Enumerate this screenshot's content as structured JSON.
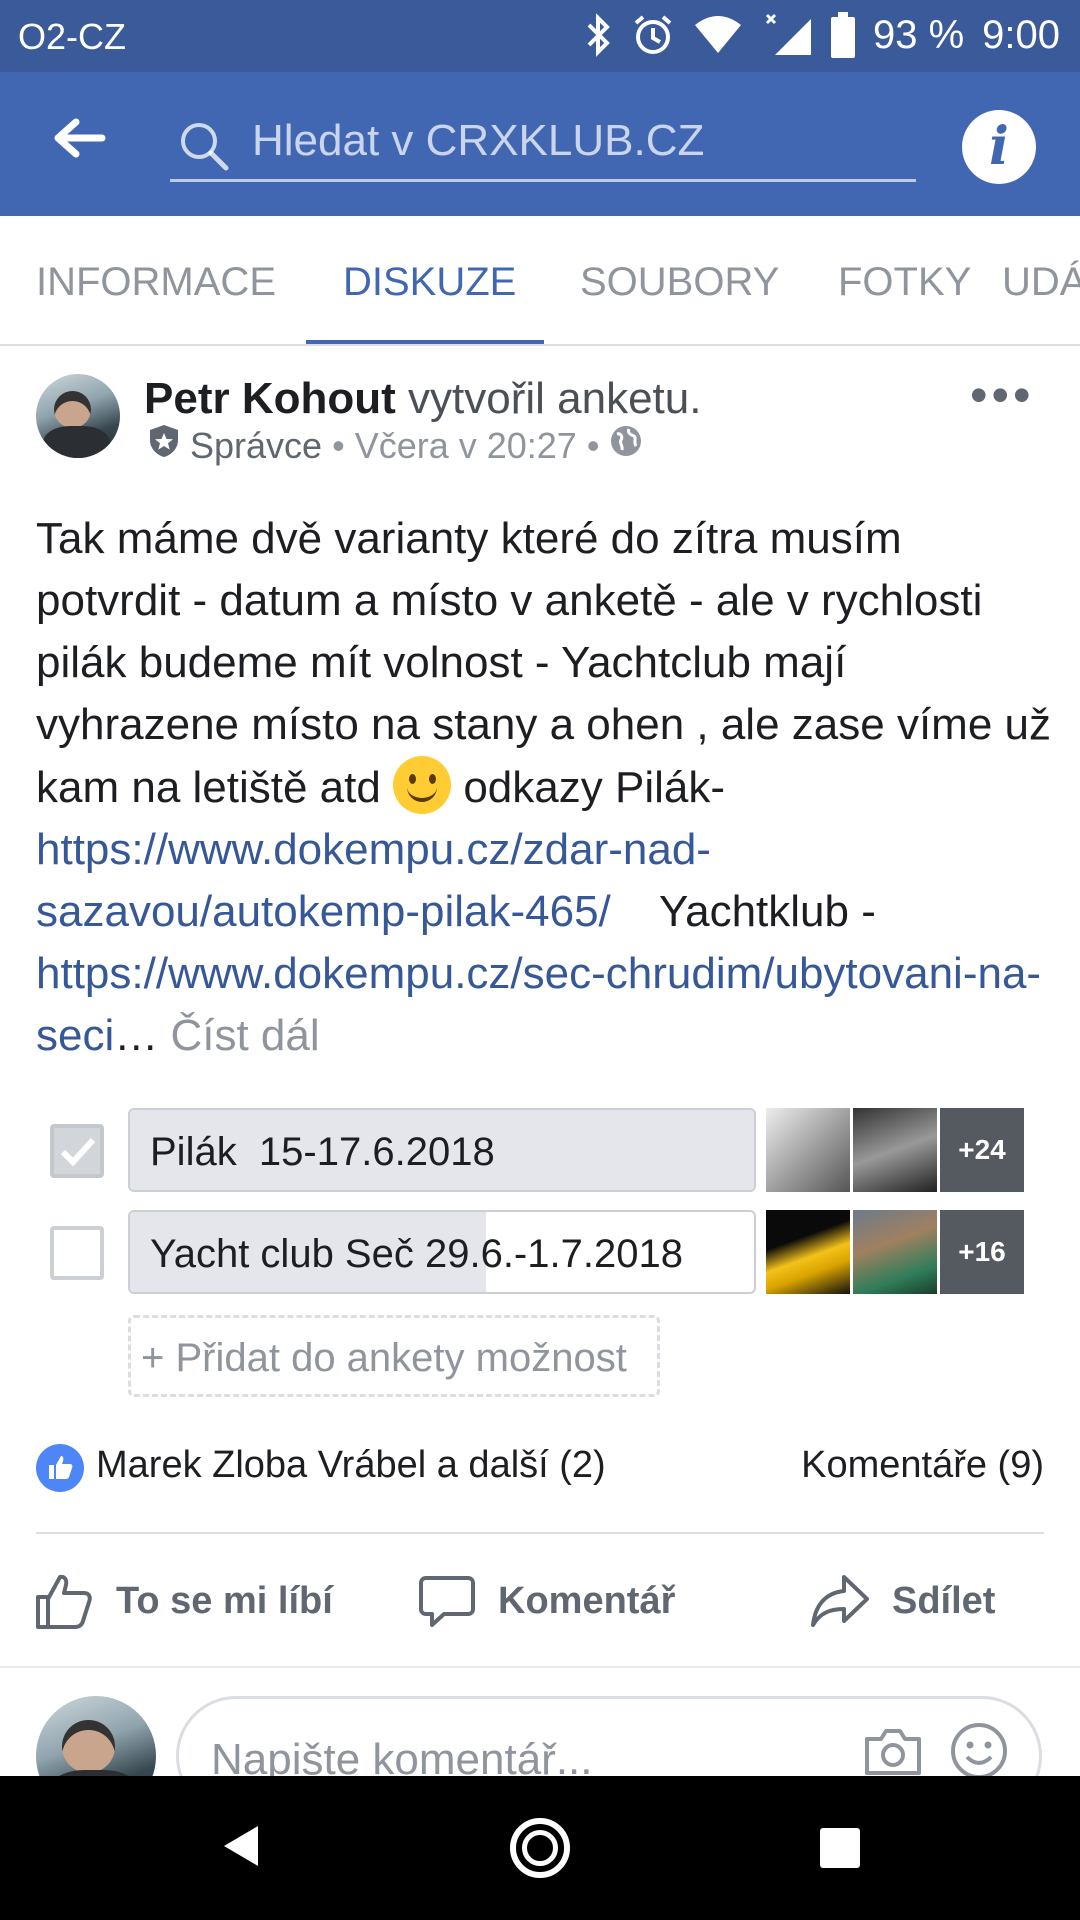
{
  "status_bar": {
    "carrier": "O2-CZ",
    "battery": "93 %",
    "time": "9:00"
  },
  "app_bar": {
    "search_placeholder": "Hledat v CRXKLUB.CZ",
    "info_label": "i"
  },
  "tabs": [
    {
      "label": "INFORMACE",
      "active": false
    },
    {
      "label": "DISKUZE",
      "active": true
    },
    {
      "label": "SOUBORY",
      "active": false
    },
    {
      "label": "FOTKY",
      "active": false
    },
    {
      "label": "UDÁLOSTI",
      "active": false
    }
  ],
  "post": {
    "author": "Petr Kohout",
    "action": "vytvořil anketu.",
    "role": "Správce",
    "time": "Včera v 20:27",
    "more": "•••",
    "text_part1": "Tak máme dvě varianty které do zítra musím potvrdit - datum a místo v anketě - ale v rychlosti pilák budeme mít volnost - Yachtclub mají vyhrazene místo na stany a ohen , ale zase víme už kam na letiště atd",
    "text_part2": "odkazy Pilák-",
    "link1": "https://www.dokempu.cz/zdar-nad-sazavou/autokemp-pilak-465/",
    "text_part3": "Yachtklub -",
    "link2": "https://www.dokempu.cz/sec-chrudim/ubytovani-na-seci",
    "ellipsis": "…",
    "see_more": "Číst dál"
  },
  "poll": {
    "options": [
      {
        "label": "Pilák  15-17.6.2018",
        "checked": true,
        "fill": 1.0,
        "more_voters": "+24"
      },
      {
        "label": "Yacht club Seč 29.6.-1.7.2018",
        "checked": false,
        "fill": 0.57,
        "more_voters": "+16"
      }
    ],
    "add_option": "+ Přidat do ankety možnost"
  },
  "reactions": {
    "likers": "Marek Zloba Vrábel a další (2)",
    "comments": "Komentáře (9)"
  },
  "actions": {
    "like": "To se mi líbí",
    "comment": "Komentář",
    "share": "Sdílet"
  },
  "composer": {
    "placeholder": "Napište komentář..."
  },
  "colors": {
    "brand_blue": "#4267b2",
    "status_bar": "#3a5a99",
    "link": "#365899"
  }
}
